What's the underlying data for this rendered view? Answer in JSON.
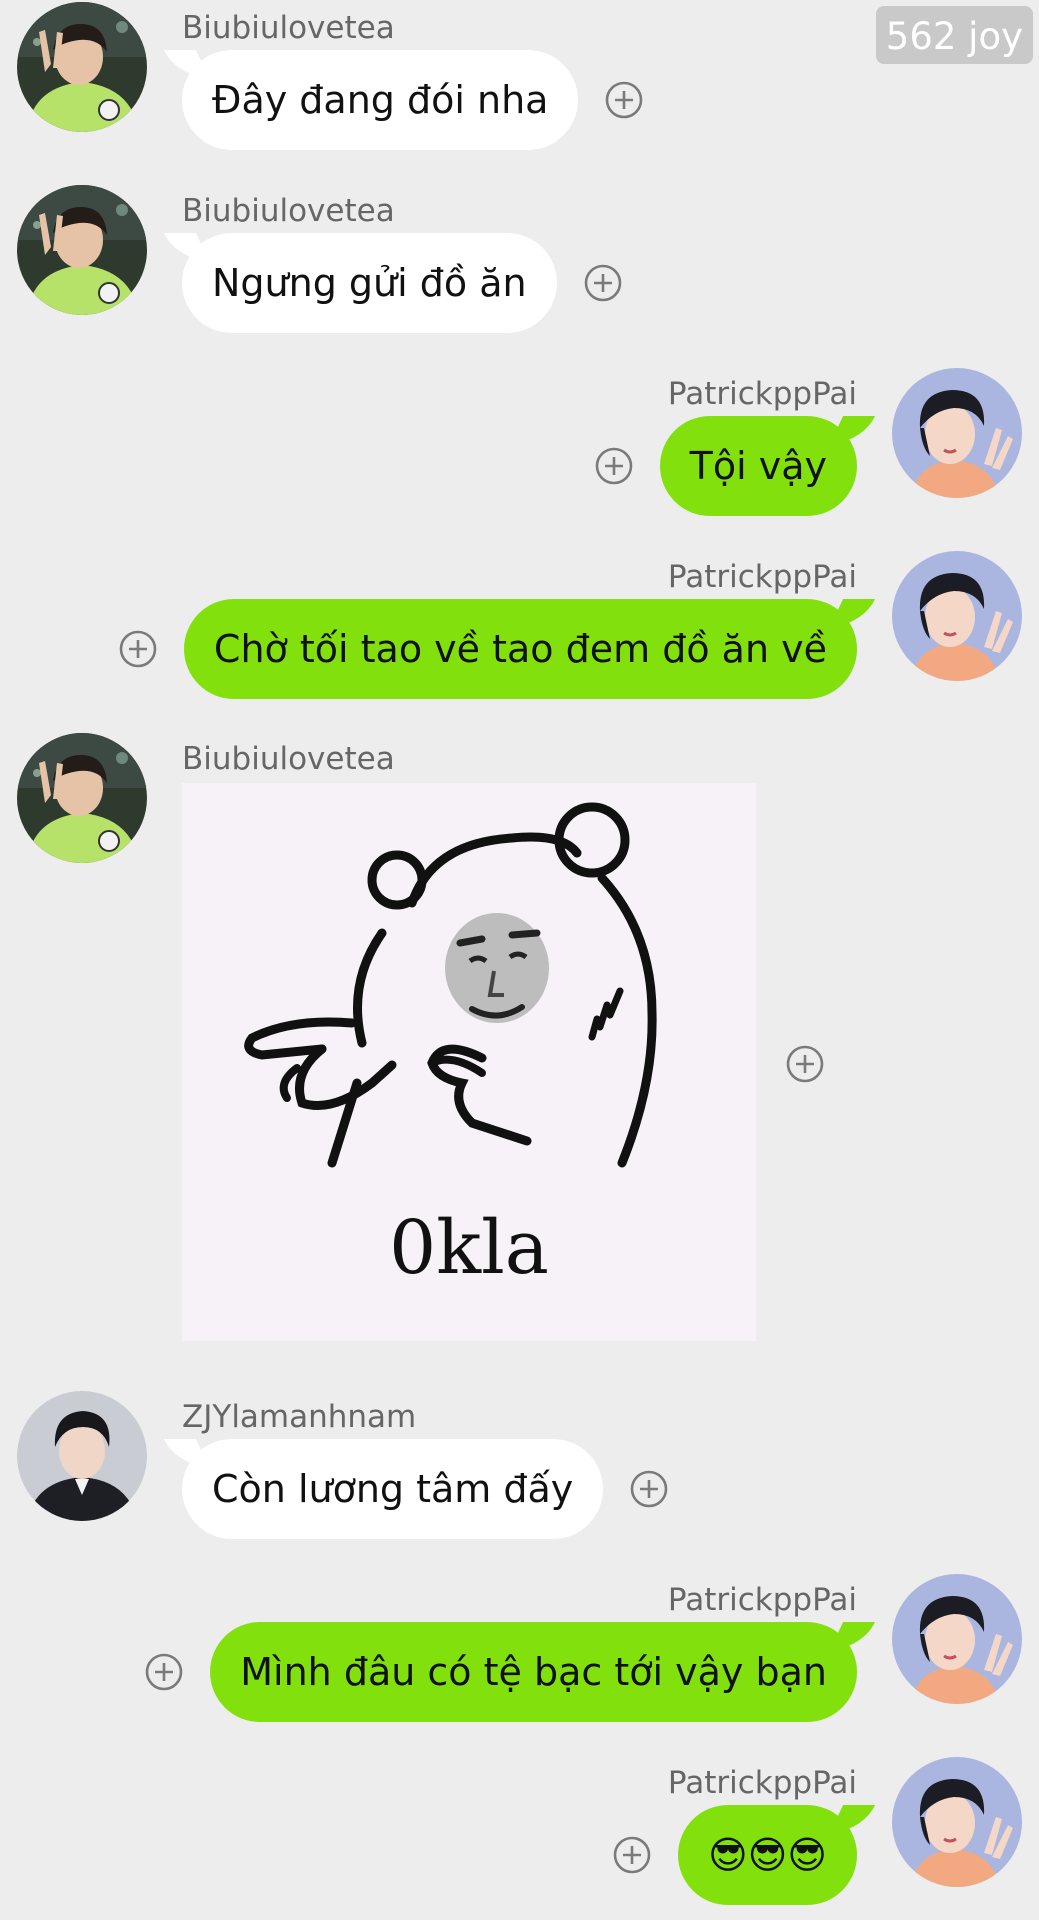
{
  "watermark": "562 joy",
  "messages": [
    {
      "user": "Biubiulovetea",
      "text": "Đây đang đói nha"
    },
    {
      "user": "Biubiulovetea",
      "text": "Ngưng gửi đồ ăn"
    },
    {
      "user": "PatrickppPai",
      "text": "Tội vậy"
    },
    {
      "user": "PatrickppPai",
      "text": "Chờ tối tao về tao đem đồ ăn về"
    },
    {
      "user": "Biubiulovetea",
      "sticker_caption": "0kla"
    },
    {
      "user": "ZJYlamanhnam",
      "text": "Còn lương tâm đấy"
    },
    {
      "user": "PatrickppPai",
      "text": "Mình đâu có tệ bạc tới vậy bạn"
    },
    {
      "user": "PatrickppPai",
      "text": "😎😎😎"
    }
  ],
  "colors": {
    "background": "#ededed",
    "incoming_bubble": "#ffffff",
    "outgoing_bubble": "#82e10c",
    "username": "#666666",
    "watermark_bg": "#c9c9c9"
  },
  "icons": {
    "plus": "plus-circle-icon",
    "avatar_biubiu": "avatar-green-sweater",
    "avatar_patrick": "avatar-dark-hair-peach-shirt",
    "avatar_zjy": "avatar-dark-jacket"
  }
}
